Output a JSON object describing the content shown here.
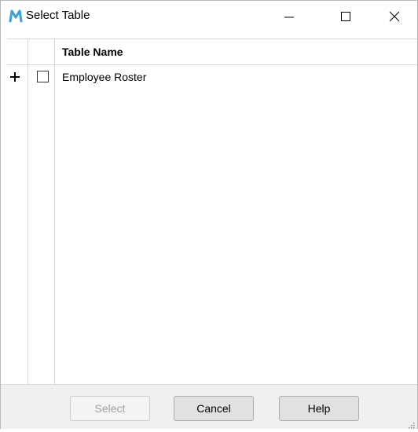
{
  "window": {
    "title": "Select Table",
    "app_icon": "m-logo-icon",
    "controls": [
      "minimize-icon",
      "maximize-icon",
      "close-icon"
    ]
  },
  "grid": {
    "columns": [
      {
        "label": ""
      },
      {
        "label": ""
      },
      {
        "label": "Table Name"
      }
    ],
    "rows": [
      {
        "expand": "plus-icon",
        "checked": false,
        "name": "Employee Roster"
      }
    ]
  },
  "footer": {
    "select_label": "Select",
    "select_enabled": false,
    "cancel_label": "Cancel",
    "help_label": "Help"
  },
  "colors": {
    "logo": "#3aa0d8",
    "disabled_text": "#a0a0a0",
    "footer_bg": "#f0f0f0"
  }
}
